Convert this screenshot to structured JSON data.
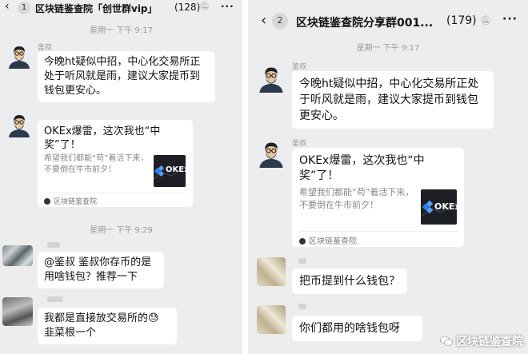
{
  "left": {
    "header": {
      "back": "‹",
      "badge": "1",
      "title": "区块链鉴查院「创世群vip」",
      "count": "(128)",
      "more": "···"
    },
    "time1": "星期一 下午 9:17",
    "msg1": {
      "name": "鉴叔",
      "text": "今晚ht疑似中招，中心化交易所正处于听风就是雨，建议大家提币到钱包更安心。"
    },
    "card": {
      "title": "OKEx爆雷，这次我也“中奖”了！",
      "desc": "希望我们都能“苟”着活下来，不要倒在牛市前夕！",
      "thumb": "OKEx",
      "source": "区块链鉴查院"
    },
    "time2": "星期一 下午 9:29",
    "msg2": {
      "text": "@鉴叔  鉴叔你存币的是用啥钱包？推荐一下"
    },
    "msg3": {
      "text": "我都是直接放交易所的😓 韭菜根一个"
    }
  },
  "right": {
    "header": {
      "back": "‹",
      "badge": "2",
      "title": "区块链鉴查院分享群001...",
      "count": "(179)",
      "more": "···"
    },
    "time1": "星期一 下午 9:17",
    "msg1": {
      "name": "鉴叔",
      "text": "今晚ht疑似中招，中心化交易所正处于听风就是雨，建议大家提币到钱包更安心。"
    },
    "card": {
      "name": "鉴叔",
      "title": "OKEx爆雷，这次我也“中奖”了！",
      "desc": "希望我们都能“苟”着活下来，不要倒在牛市前夕！",
      "thumb": "OKEx",
      "source": "区块链鉴查院"
    },
    "msg2": {
      "text": "把币提到什么钱包？"
    },
    "msg3": {
      "text": "你们都用的啥钱包呀"
    },
    "watermark": "区块链鉴查院"
  }
}
